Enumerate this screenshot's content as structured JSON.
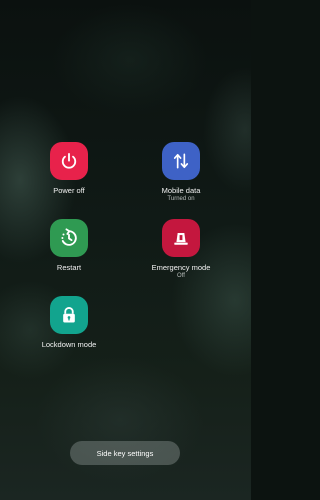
{
  "power_menu": {
    "power_off": {
      "label": "Power off",
      "icon": "power-icon",
      "color": "#e8224b"
    },
    "mobile_data": {
      "label": "Mobile data",
      "status": "Turned on",
      "icon": "data-arrows-icon",
      "color": "#3e62c6"
    },
    "restart": {
      "label": "Restart",
      "icon": "restart-icon",
      "color": "#2f9a52"
    },
    "emergency_mode": {
      "label": "Emergency mode",
      "status": "Off",
      "icon": "emergency-light-icon",
      "color": "#c4173e"
    },
    "lockdown_mode": {
      "label": "Lockdown mode",
      "icon": "lock-icon",
      "color": "#12a48e"
    }
  },
  "side_key_settings": {
    "label": "Side key settings"
  }
}
